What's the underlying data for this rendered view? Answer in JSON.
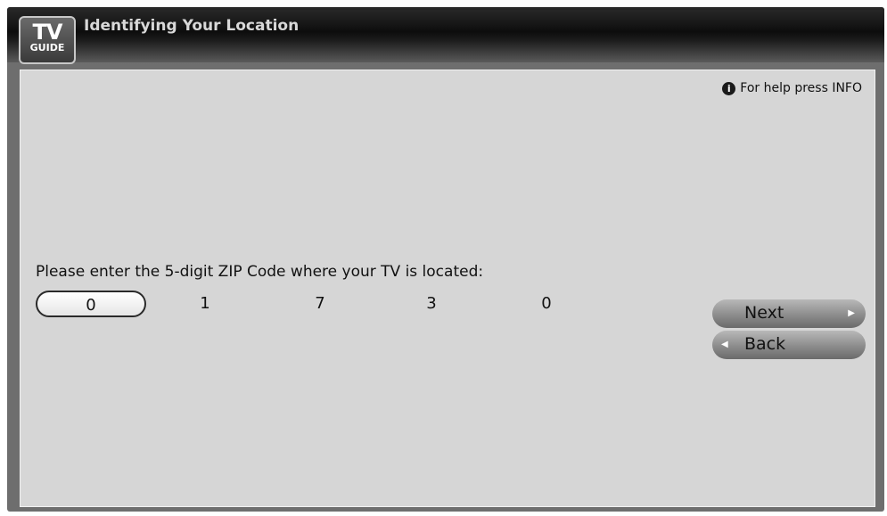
{
  "header": {
    "logo_top": "TV",
    "logo_bottom": "GUIDE",
    "title": "Identifying Your Location"
  },
  "help": {
    "icon_glyph": "i",
    "text": "For help press INFO"
  },
  "zip": {
    "prompt": "Please enter the 5-digit ZIP Code where your TV is located:",
    "digits": [
      "0",
      "1",
      "7",
      "3",
      "0"
    ],
    "selected_index": 0
  },
  "buttons": {
    "next_label": "Next",
    "back_label": "Back"
  },
  "colors": {
    "titlebar": "#0d0d0d",
    "panel": "#d6d6d6",
    "frame": "#6e6e6e"
  }
}
